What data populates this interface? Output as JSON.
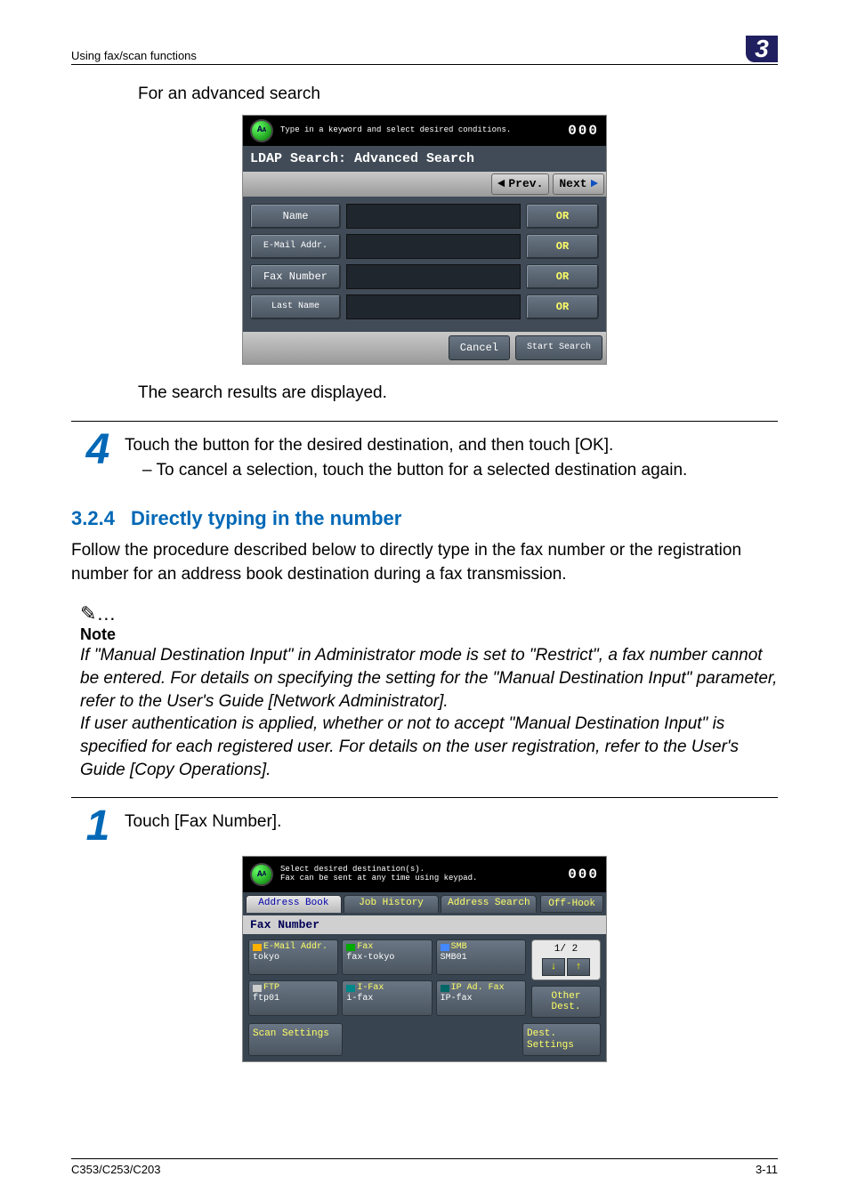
{
  "header": {
    "left": "Using fax/scan functions",
    "right": "3"
  },
  "intro_advanced": "For an advanced search",
  "ldap": {
    "top_help": "Type in a keyword and select desired conditions.",
    "top_count": "000",
    "title": "LDAP Search: Advanced Search",
    "prev": "Prev.",
    "next": "Next",
    "rows": [
      {
        "label": "Name",
        "cond": "OR"
      },
      {
        "label": "E-Mail Addr.",
        "cond": "OR"
      },
      {
        "label": "Fax Number",
        "cond": "OR"
      },
      {
        "label": "Last Name",
        "cond": "OR"
      }
    ],
    "cancel": "Cancel",
    "start": "Start Search"
  },
  "results_text": "The search results are displayed.",
  "step4": {
    "num": "4",
    "line1": "Touch the button for the desired destination, and then touch [OK].",
    "bullet": "– To cancel a selection, touch the button for a selected destination again."
  },
  "section": {
    "num": "3.2.4",
    "title": "Directly typing in the number",
    "para": "Follow the procedure described below to directly type in the fax number or the registration number for an address book destination during a fax transmission."
  },
  "note": {
    "icon": "✎…",
    "label": "Note",
    "body1": "If \"Manual Destination Input\" in Administrator mode is set to \"Restrict\", a fax number cannot be entered. For details on specifying the setting for the \"Manual Destination Input\" parameter, refer to the User's Guide [Network Administrator].",
    "body2": "If user authentication is applied, whether or not to accept \"Manual Destination Input\" is specified for each registered user. For details on the user registration, refer to the User's Guide [Copy Operations]."
  },
  "step1": {
    "num": "1",
    "line": "Touch [Fax Number]."
  },
  "fax": {
    "top1": "Select desired destination(s).",
    "top2": "Fax can be sent at any time using keypad.",
    "top_count": "000",
    "tabs": {
      "book": "Address Book",
      "history": "Job History",
      "search": "Address Search"
    },
    "offhook": "Off-Hook",
    "strip": "Fax Number",
    "dest": [
      {
        "type": "E-Mail Addr.",
        "value": "tokyo",
        "icon": "mi-mail"
      },
      {
        "type": "Fax",
        "value": "fax-tokyo",
        "icon": "mi-fax"
      },
      {
        "type": "SMB",
        "value": "SMB01",
        "icon": "mi-smb"
      },
      {
        "type": "FTP",
        "value": "ftp01",
        "icon": "mi-ftp"
      },
      {
        "type": "I-Fax",
        "value": "i-fax",
        "icon": "mi-ifax"
      },
      {
        "type": "IP Ad. Fax",
        "value": "IP-fax",
        "icon": "mi-ip"
      }
    ],
    "pager": "1/   2",
    "other": "Other Dest.",
    "scan": "Scan Settings",
    "destset": "Dest. Settings"
  },
  "footer": {
    "left": "C353/C253/C203",
    "right": "3-11"
  }
}
